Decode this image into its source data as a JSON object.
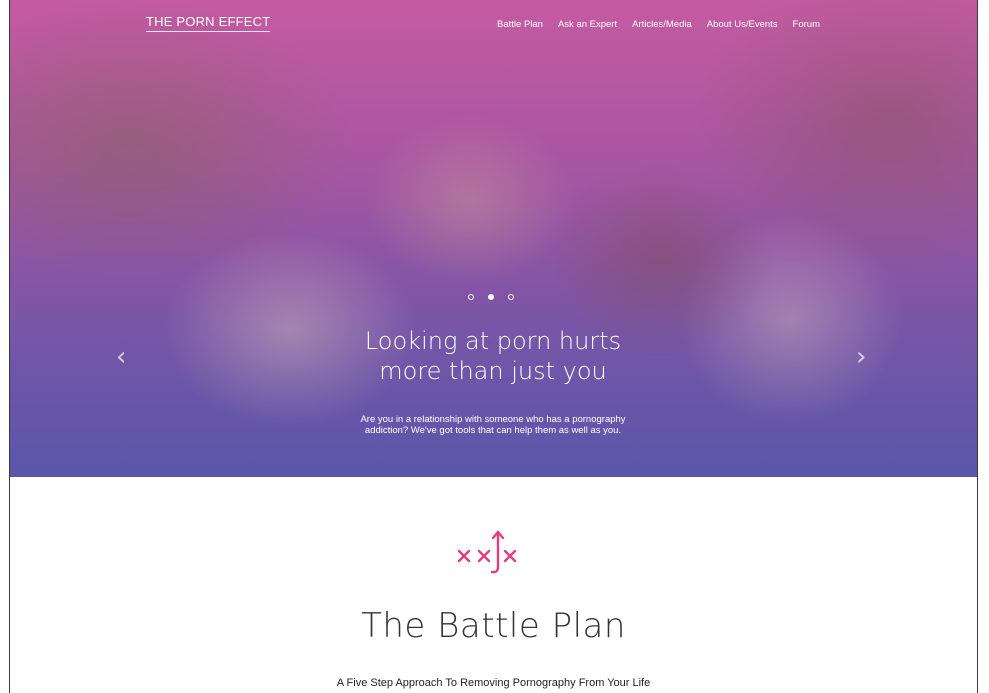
{
  "site": {
    "logo": "THE PORN EFFECT"
  },
  "nav": {
    "items": [
      {
        "label": "Battle Plan"
      },
      {
        "label": "Ask an Expert"
      },
      {
        "label": "Articles/Media"
      },
      {
        "label": "About Us/Events"
      },
      {
        "label": "Forum"
      }
    ]
  },
  "hero": {
    "headline_line1": "Looking at porn hurts",
    "headline_line2": "more than just you",
    "subtext_line1": "Are you in a relationship with someone who has a pornography",
    "subtext_line2": "addiction? We've got tools that can help them as well as you.",
    "slides": {
      "count": 3,
      "active_index": 1
    },
    "prev_icon": "chevron-left-icon",
    "next_icon": "chevron-right-icon"
  },
  "battle_plan": {
    "icon": "battle-plan-icon",
    "title": "The Battle Plan",
    "subtitle": "A Five Step Approach To Removing Pornography From Your Life"
  },
  "colors": {
    "accent": "#e33d7e",
    "hero_overlay_top": "#c2609d",
    "hero_overlay_bottom": "#5f59a8"
  }
}
